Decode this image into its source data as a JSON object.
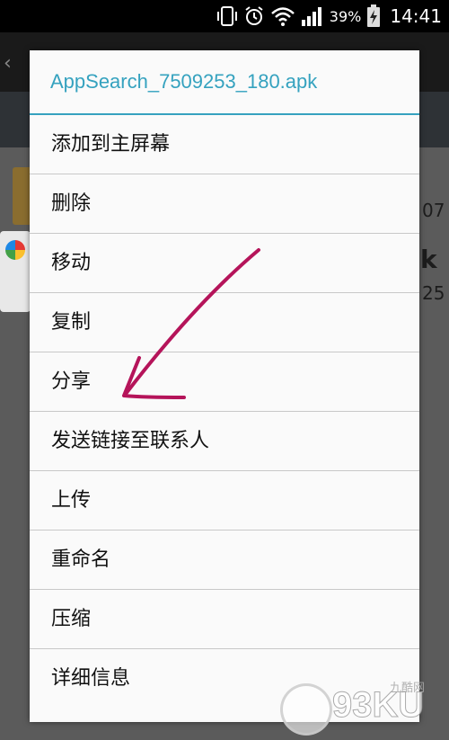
{
  "status_bar": {
    "battery_percent": "39%",
    "time": "14:41",
    "icons": [
      "vibrate-icon",
      "alarm-icon",
      "wifi-icon",
      "signal-icon",
      "battery-charging-icon"
    ]
  },
  "background": {
    "edge_text_1": "07",
    "edge_text_2": "k",
    "edge_text_3": "25"
  },
  "dialog": {
    "title": "AppSearch_7509253_180.apk",
    "items": [
      {
        "label": "添加到主屏幕"
      },
      {
        "label": "删除"
      },
      {
        "label": "移动"
      },
      {
        "label": "复制"
      },
      {
        "label": "分享"
      },
      {
        "label": "发送链接至联系人"
      },
      {
        "label": "上传"
      },
      {
        "label": "重命名"
      },
      {
        "label": "压缩"
      },
      {
        "label": "详细信息"
      }
    ]
  },
  "annotation": {
    "color": "#b5145a"
  },
  "watermark": {
    "text": "93KU",
    "small_text": "九酷网"
  },
  "colors": {
    "accent": "#35a2bf"
  }
}
